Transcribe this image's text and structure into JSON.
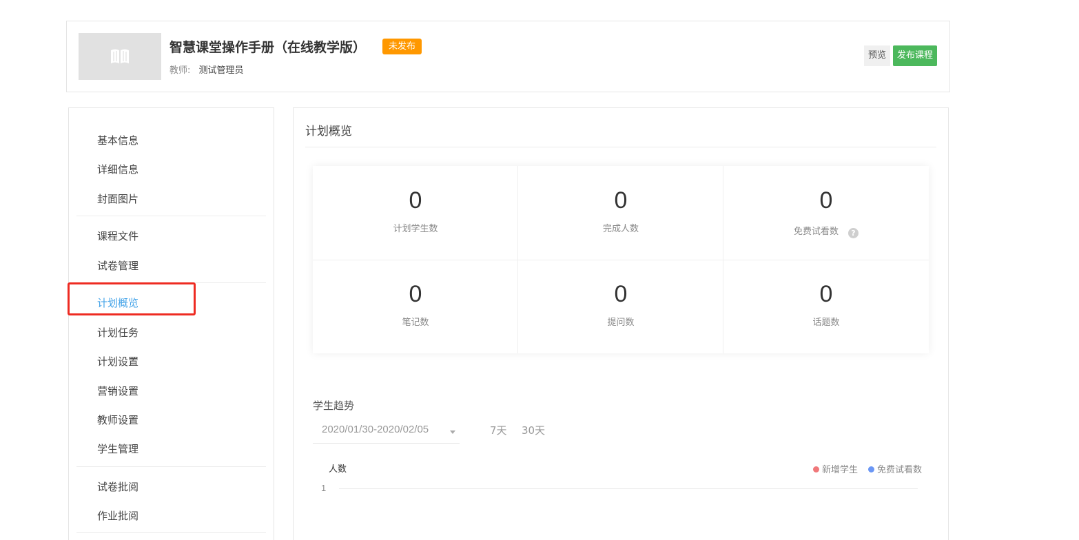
{
  "course": {
    "title": "智慧课堂操作手册（在线教学版）",
    "status": "未发布",
    "teacher_label": "教师:",
    "teacher_name": "测试管理员",
    "cover_icon": "book-icon"
  },
  "actions": {
    "preview_label": "预览",
    "publish_label": "发布课程"
  },
  "sidebar": {
    "items": [
      {
        "label": "基本信息"
      },
      {
        "label": "详细信息"
      },
      {
        "label": "封面图片"
      },
      {
        "label": "课程文件"
      },
      {
        "label": "试卷管理"
      },
      {
        "label": "计划概览",
        "active": true
      },
      {
        "label": "计划任务"
      },
      {
        "label": "计划设置"
      },
      {
        "label": "营销设置"
      },
      {
        "label": "教师设置"
      },
      {
        "label": "学生管理"
      },
      {
        "label": "试卷批阅"
      },
      {
        "label": "作业批阅"
      }
    ]
  },
  "overview": {
    "title": "计划概览",
    "stats": [
      {
        "value": "0",
        "label": "计划学生数"
      },
      {
        "value": "0",
        "label": "完成人数"
      },
      {
        "value": "0",
        "label": "免费试看数",
        "help_icon": "question-icon",
        "help_glyph": "?"
      },
      {
        "value": "0",
        "label": "笔记数"
      },
      {
        "value": "0",
        "label": "提问数"
      },
      {
        "value": "0",
        "label": "话题数"
      }
    ]
  },
  "trend": {
    "title": "学生趋势",
    "date_range": "2020/01/30-2020/02/05",
    "range_options": [
      "7天",
      "30天"
    ]
  },
  "chart_data": {
    "type": "line",
    "ylabel": "人数",
    "y_ticks": [
      "1"
    ],
    "series": [
      {
        "name": "新增学生",
        "color": "#f0787a",
        "values": []
      },
      {
        "name": "免费试看数",
        "color": "#6b97f5",
        "values": []
      }
    ]
  },
  "colors": {
    "accent": "#43a3e8",
    "publish": "#4cb85c",
    "status_badge": "#ff9800",
    "highlight": "#ee2b22"
  }
}
